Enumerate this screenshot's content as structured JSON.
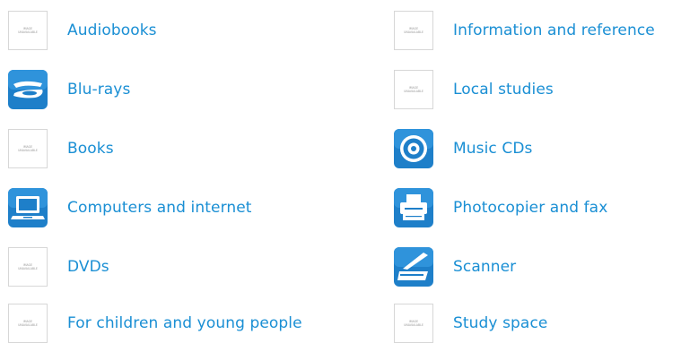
{
  "placeholder": {
    "line1": "IMAGE",
    "line2": "UNAVAILABLE"
  },
  "colors": {
    "link": "#1a8fd4",
    "icon_blue": "#1e7fc9"
  },
  "left_column": [
    {
      "label": "Audiobooks",
      "icon": "image-unavailable"
    },
    {
      "label": "Blu-rays",
      "icon": "bluray-disc-icon"
    },
    {
      "label": "Books",
      "icon": "image-unavailable"
    },
    {
      "label": "Computers and internet",
      "icon": "laptop-icon"
    },
    {
      "label": "DVDs",
      "icon": "image-unavailable"
    },
    {
      "label": "For children and young people",
      "icon": "image-unavailable"
    }
  ],
  "right_column": [
    {
      "label": "Information and reference",
      "icon": "image-unavailable"
    },
    {
      "label": "Local studies",
      "icon": "image-unavailable"
    },
    {
      "label": "Music CDs",
      "icon": "cd-disc-icon"
    },
    {
      "label": "Photocopier and fax",
      "icon": "printer-icon"
    },
    {
      "label": "Scanner",
      "icon": "scanner-icon"
    },
    {
      "label": "Study space",
      "icon": "image-unavailable"
    }
  ]
}
